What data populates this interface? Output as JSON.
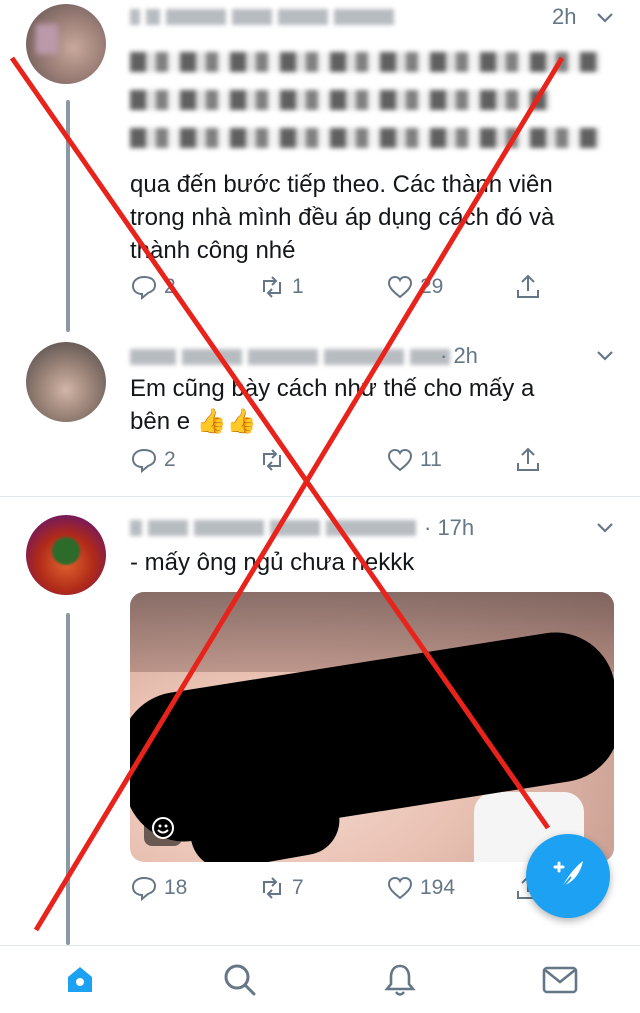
{
  "tweets": [
    {
      "time": "2h",
      "text_visible": "qua đến bước tiếp theo. Các thành viên\ntrong nhà mình đều áp dụng cách đó và\nthành công nhé",
      "counts": {
        "replies": "2",
        "retweets": "1",
        "likes": "29"
      }
    },
    {
      "time": "· 2h",
      "text": "Em cũng bày cách như thế cho mấy a\nbên e 👍👍",
      "counts": {
        "replies": "2",
        "retweets": "",
        "likes": "11"
      }
    },
    {
      "time": "· 17h",
      "text": "- mấy ông ngủ chưa nekkk",
      "counts": {
        "replies": "18",
        "retweets": "7",
        "likes": "194"
      }
    }
  ],
  "icons": {
    "reply": "reply-icon",
    "retweet": "retweet-icon",
    "like": "heart-icon",
    "share": "share-icon",
    "more": "chevron-down-icon",
    "compose": "compose-tweet-icon",
    "gif": "smiley-icon"
  },
  "nav": [
    "home-icon",
    "search-icon",
    "notifications-icon",
    "messages-icon"
  ],
  "colors": {
    "accent": "#1da1f2",
    "overlay_x": "#e8231b",
    "muted_text": "#657786"
  }
}
